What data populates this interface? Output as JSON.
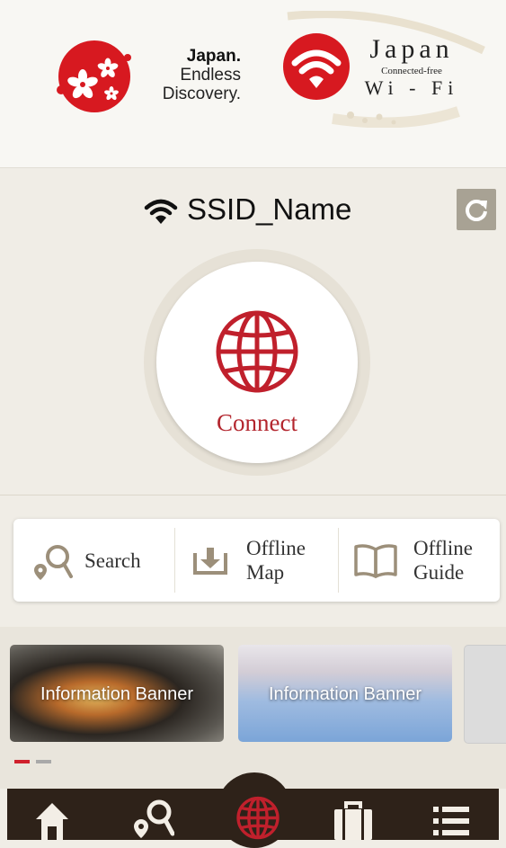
{
  "header": {
    "brand_left": {
      "line1": "Japan.",
      "line2": "Endless",
      "line3": "Discovery."
    },
    "brand_right": {
      "line1": "Japan",
      "line2": "Connected-free",
      "line3": "Wi - Fi"
    }
  },
  "network": {
    "ssid": "SSID_Name"
  },
  "connect": {
    "label": "Connect"
  },
  "toolbar": {
    "items": [
      {
        "label": "Search",
        "icon": "map-search-icon"
      },
      {
        "label_line1": "Offline",
        "label_line2": "Map",
        "icon": "download-tray-icon"
      },
      {
        "label_line1": "Offline",
        "label_line2": "Guide",
        "icon": "open-book-icon"
      }
    ]
  },
  "banners": [
    {
      "caption": "Information Banner"
    },
    {
      "caption": "Information Banner"
    }
  ],
  "pager": {
    "active": 0,
    "count": 2
  },
  "tabbar": {
    "tabs": [
      {
        "icon": "home-icon"
      },
      {
        "icon": "map-search-icon"
      },
      {
        "icon": "globe-icon",
        "active": true
      },
      {
        "icon": "suitcase-icon"
      },
      {
        "icon": "menu-list-icon"
      }
    ]
  },
  "colors": {
    "accent": "#c0202c",
    "background": "#f0ede6",
    "tabbar": "#2e2219",
    "icon_tan": "#9c8f7a"
  }
}
